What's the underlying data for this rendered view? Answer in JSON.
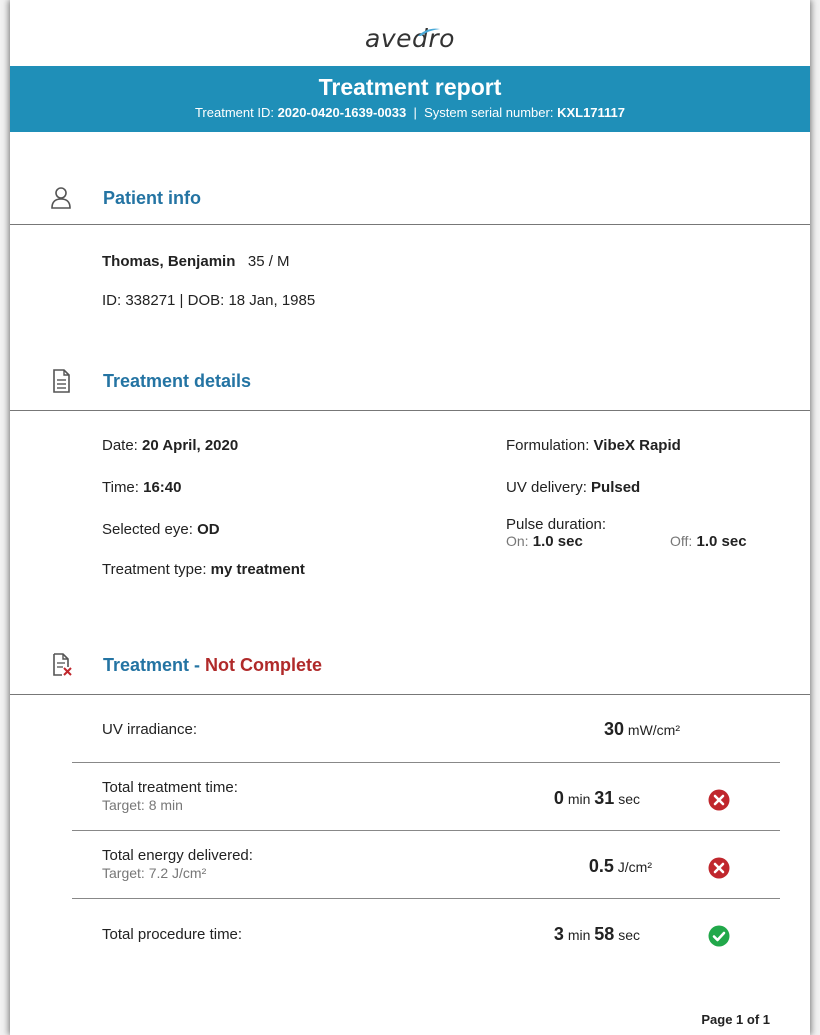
{
  "brand": {
    "logo_text": "avedro"
  },
  "header": {
    "title": "Treatment report",
    "treatment_id_label": "Treatment ID:",
    "treatment_id": "2020-0420-1639-0033",
    "separator": "|",
    "serial_label": "System serial number:",
    "serial": "KXL171117"
  },
  "patient": {
    "section_title": "Patient info",
    "icon": "user-icon",
    "name": "Thomas, Benjamin",
    "age_sex": "35 / M",
    "id_dob": "ID: 338271 | DOB: 18 Jan, 1985"
  },
  "details": {
    "section_title": "Treatment details",
    "icon": "document-icon",
    "date_label": "Date:",
    "date": "20 April, 2020",
    "time_label": "Time:",
    "time": "16:40",
    "eye_label": "Selected eye:",
    "eye": "OD",
    "type_label": "Treatment type:",
    "type": "my treatment",
    "formulation_label": "Formulation:",
    "formulation": "VibeX Rapid",
    "uv_delivery_label": "UV delivery:",
    "uv_delivery": "Pulsed",
    "pulse_label": "Pulse duration:",
    "pulse_on_label": "On:",
    "pulse_on": "1.0 sec",
    "pulse_off_label": "Off:",
    "pulse_off": "1.0 sec"
  },
  "treatment": {
    "section_title": "Treatment - ",
    "status": "Not Complete",
    "status_color": "#b02a2a",
    "icon": "document-error-icon",
    "rows": [
      {
        "label": "UV irradiance:",
        "target": "",
        "value_main": "30",
        "unit_main": "mW/cm²",
        "value_secondary": "",
        "unit_secondary": "",
        "status": ""
      },
      {
        "label": "Total treatment time:",
        "target": "Target: 8 min",
        "value_main": "0",
        "unit_main": "min",
        "value_secondary": "31",
        "unit_secondary": "sec",
        "status": "fail-icon"
      },
      {
        "label": "Total energy delivered:",
        "target": "Target: 7.2 J/cm²",
        "value_main": "0.5",
        "unit_main": "J/cm²",
        "value_secondary": "",
        "unit_secondary": "",
        "status": "fail-icon"
      },
      {
        "label": "Total procedure time:",
        "target": "",
        "value_main": "3",
        "unit_main": "min",
        "value_secondary": "58",
        "unit_secondary": "sec",
        "status": "pass-icon"
      }
    ]
  },
  "colors": {
    "banner": "#1f8fb8",
    "section_title": "#2474a3",
    "fail": "#c0272d",
    "pass": "#21a84a"
  },
  "footer": {
    "page": "Page 1 of 1"
  }
}
